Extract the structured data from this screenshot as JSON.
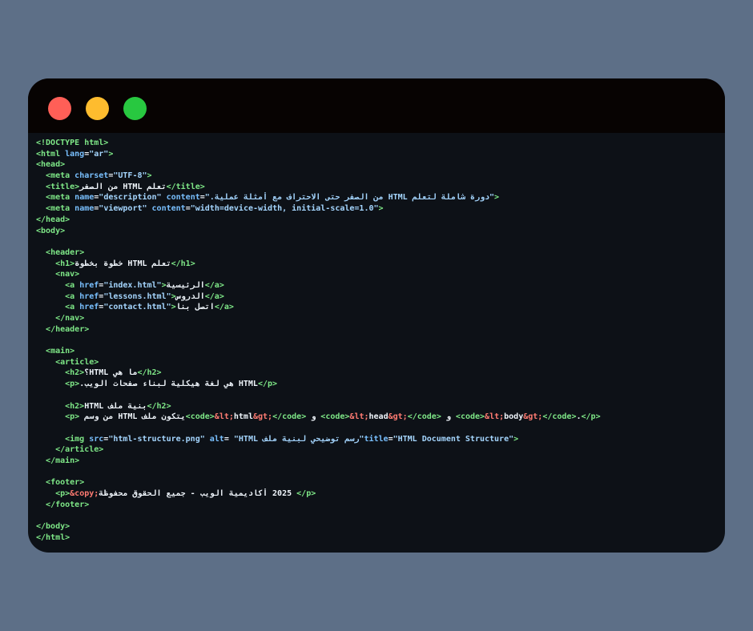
{
  "colors": {
    "background": "#5d6f87",
    "window": "#0d1117",
    "titlebar": "#070302",
    "close": "#ff5f57",
    "minimize": "#febc2e",
    "maximize": "#28c840",
    "tag": "#7ee787",
    "attr": "#79c0ff",
    "string": "#a5d6ff",
    "text": "#f0f6fc",
    "entity": "#ff7b72"
  },
  "code_lines": [
    [
      [
        "t",
        "<!DOCTYPE html>"
      ]
    ],
    [
      [
        "t",
        "<html "
      ],
      [
        "a",
        "lang"
      ],
      [
        "x",
        "="
      ],
      [
        "s",
        "\"ar\""
      ],
      [
        "t",
        ">"
      ]
    ],
    [
      [
        "t",
        "<head>"
      ]
    ],
    [
      [
        "x",
        "  "
      ],
      [
        "t",
        "<meta "
      ],
      [
        "a",
        "charset"
      ],
      [
        "x",
        "="
      ],
      [
        "s",
        "\"UTF-8\""
      ],
      [
        "t",
        ">"
      ]
    ],
    [
      [
        "x",
        "  "
      ],
      [
        "t",
        "<title>"
      ],
      [
        "x",
        "تعلم HTML من الصفر"
      ],
      [
        "t",
        "</title>"
      ]
    ],
    [
      [
        "x",
        "  "
      ],
      [
        "t",
        "<meta "
      ],
      [
        "a",
        "name"
      ],
      [
        "x",
        "="
      ],
      [
        "s",
        "\"description\" "
      ],
      [
        "a",
        "content"
      ],
      [
        "x",
        "="
      ],
      [
        "s",
        "\"دورة شاملة لتعلم HTML من الصفر حتى الاحتراف مع أمثلة عملية.\""
      ],
      [
        "t",
        ">"
      ]
    ],
    [
      [
        "x",
        "  "
      ],
      [
        "t",
        "<meta "
      ],
      [
        "a",
        "name"
      ],
      [
        "x",
        "="
      ],
      [
        "s",
        "\"viewport\" "
      ],
      [
        "a",
        "content"
      ],
      [
        "x",
        "="
      ],
      [
        "s",
        "\"width=device-width, initial-scale=1.0\""
      ],
      [
        "t",
        ">"
      ]
    ],
    [
      [
        "t",
        "</head>"
      ]
    ],
    [
      [
        "t",
        "<body>"
      ]
    ],
    [],
    [
      [
        "x",
        "  "
      ],
      [
        "t",
        "<header>"
      ]
    ],
    [
      [
        "x",
        "    "
      ],
      [
        "t",
        "<h1>"
      ],
      [
        "x",
        "تعلم HTML خطوة بخطوة"
      ],
      [
        "t",
        "</h1>"
      ]
    ],
    [
      [
        "x",
        "    "
      ],
      [
        "t",
        "<nav>"
      ]
    ],
    [
      [
        "x",
        "      "
      ],
      [
        "t",
        "<a "
      ],
      [
        "a",
        "href"
      ],
      [
        "x",
        "="
      ],
      [
        "s",
        "\"index.html\""
      ],
      [
        "t",
        ">"
      ],
      [
        "x",
        "الرئيسية"
      ],
      [
        "t",
        "</a>"
      ]
    ],
    [
      [
        "x",
        "      "
      ],
      [
        "t",
        "<a "
      ],
      [
        "a",
        "href"
      ],
      [
        "x",
        "="
      ],
      [
        "s",
        "\"lessons.html\""
      ],
      [
        "t",
        ">"
      ],
      [
        "x",
        "الدروس"
      ],
      [
        "t",
        "</a>"
      ]
    ],
    [
      [
        "x",
        "      "
      ],
      [
        "t",
        "<a "
      ],
      [
        "a",
        "href"
      ],
      [
        "x",
        "="
      ],
      [
        "s",
        "\"contact.html\""
      ],
      [
        "t",
        ">"
      ],
      [
        "x",
        "اتصل بنا"
      ],
      [
        "t",
        "</a>"
      ]
    ],
    [
      [
        "x",
        "    "
      ],
      [
        "t",
        "</nav>"
      ]
    ],
    [
      [
        "x",
        "  "
      ],
      [
        "t",
        "</header>"
      ]
    ],
    [],
    [
      [
        "x",
        "  "
      ],
      [
        "t",
        "<main>"
      ]
    ],
    [
      [
        "x",
        "    "
      ],
      [
        "t",
        "<article>"
      ]
    ],
    [
      [
        "x",
        "      "
      ],
      [
        "t",
        "<h2>"
      ],
      [
        "x",
        "ما هي HTML؟"
      ],
      [
        "t",
        "</h2>"
      ]
    ],
    [
      [
        "x",
        "      "
      ],
      [
        "t",
        "<p>"
      ],
      [
        "x",
        "HTML هي لغة هيكلية لبناء صفحات الويب."
      ],
      [
        "t",
        "</p>"
      ]
    ],
    [],
    [
      [
        "x",
        "      "
      ],
      [
        "t",
        "<h2>"
      ],
      [
        "x",
        "بنية ملف HTML"
      ],
      [
        "t",
        "</h2>"
      ]
    ],
    [
      [
        "x",
        "      "
      ],
      [
        "t",
        "<p>"
      ],
      [
        "x",
        "يتكون ملف HTML من وسم "
      ],
      [
        "t",
        "<code>"
      ],
      [
        "e",
        "&lt;"
      ],
      [
        "x",
        "html"
      ],
      [
        "e",
        "&gt;"
      ],
      [
        "t",
        "</code>"
      ],
      [
        "x",
        " و "
      ],
      [
        "t",
        "<code>"
      ],
      [
        "e",
        "&lt;"
      ],
      [
        "x",
        "head"
      ],
      [
        "e",
        "&gt;"
      ],
      [
        "t",
        "</code>"
      ],
      [
        "x",
        " و "
      ],
      [
        "t",
        "<code>"
      ],
      [
        "e",
        "&lt;"
      ],
      [
        "x",
        "body"
      ],
      [
        "e",
        "&gt;"
      ],
      [
        "t",
        "</code>"
      ],
      [
        "x",
        "."
      ],
      [
        "t",
        "</p>"
      ]
    ],
    [],
    [
      [
        "x",
        "      "
      ],
      [
        "t",
        "<img "
      ],
      [
        "a",
        "src"
      ],
      [
        "x",
        "="
      ],
      [
        "s",
        "\"html-structure.png\" "
      ],
      [
        "a",
        "alt"
      ],
      [
        "x",
        "="
      ],
      [
        "s",
        "\"رسم توضيحي لبنية ملف HTML\" "
      ],
      [
        "a",
        "title"
      ],
      [
        "x",
        "="
      ],
      [
        "s",
        "\"HTML Document Structure\""
      ],
      [
        "t",
        ">"
      ]
    ],
    [
      [
        "x",
        "    "
      ],
      [
        "t",
        "</article>"
      ]
    ],
    [
      [
        "x",
        "  "
      ],
      [
        "t",
        "</main>"
      ]
    ],
    [],
    [
      [
        "x",
        "  "
      ],
      [
        "t",
        "<footer>"
      ]
    ],
    [
      [
        "x",
        "    "
      ],
      [
        "t",
        "<p>"
      ],
      [
        "e",
        "&copy;"
      ],
      [
        "x",
        " 2025 أكاديمية الويب - جميع الحقوق محفوظة"
      ],
      [
        "t",
        "</p>"
      ]
    ],
    [
      [
        "x",
        "  "
      ],
      [
        "t",
        "</footer>"
      ]
    ],
    [],
    [
      [
        "t",
        "</body>"
      ]
    ],
    [
      [
        "t",
        "</html>"
      ]
    ]
  ]
}
